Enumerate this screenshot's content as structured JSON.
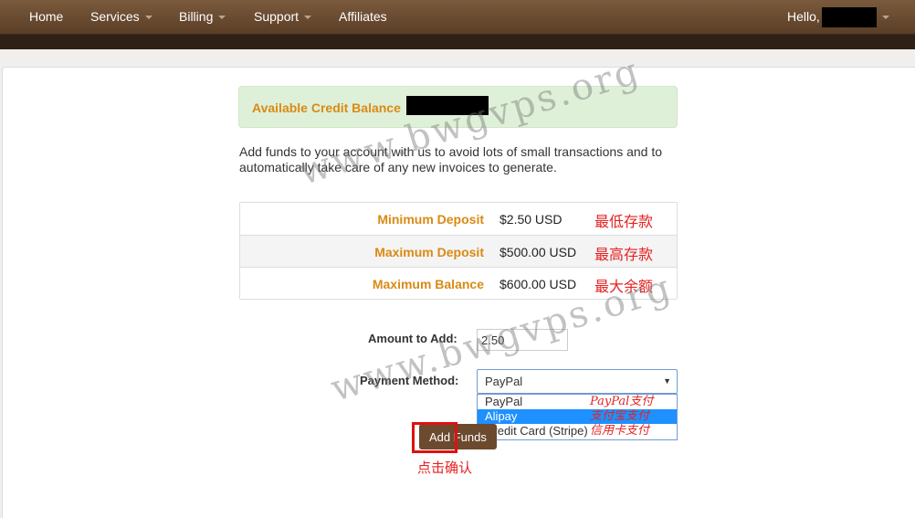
{
  "nav": {
    "items": [
      {
        "label": "Home"
      },
      {
        "label": "Services"
      },
      {
        "label": "Billing"
      },
      {
        "label": "Support"
      },
      {
        "label": "Affiliates"
      }
    ],
    "greeting": "Hello,"
  },
  "alert": {
    "text": "Available Credit Balance"
  },
  "intro": "Add funds to your account with us to avoid lots of small transactions and to automatically take care of any new invoices to generate.",
  "limits": [
    {
      "label": "Minimum Deposit",
      "value": "$2.50 USD",
      "note": "最低存款"
    },
    {
      "label": "Maximum Deposit",
      "value": "$500.00 USD",
      "note": "最高存款"
    },
    {
      "label": "Maximum Balance",
      "value": "$600.00 USD",
      "note": "最大余额"
    }
  ],
  "form": {
    "amount_label": "Amount to Add:",
    "amount_value": "2.50",
    "payment_label": "Payment Method:",
    "payment_selected": "PayPal",
    "options": [
      {
        "label": "PayPal",
        "note": "PayPal支付"
      },
      {
        "label": "Alipay",
        "note": "支付宝支付"
      },
      {
        "label": "Credit Card (Stripe)",
        "note": "信用卡支付"
      }
    ],
    "submit_label": "Add Funds",
    "confirm_note": "点击确认"
  },
  "watermark": "www.bwgvps.org",
  "colors": {
    "nav_brown": "#6b4a2e",
    "accent_orange": "#d98a14",
    "annotation_red": "#e52222",
    "alert_green": "#dff0d8",
    "option_selected": "#1e90ff"
  }
}
